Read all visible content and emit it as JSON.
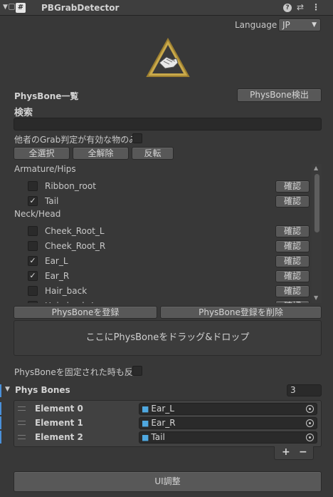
{
  "header": {
    "title": "PBGrabDetector",
    "script_icon": "#"
  },
  "language": {
    "label": "Language",
    "value": "JP"
  },
  "logo": {
    "icon": "grab-hand-warning-icon"
  },
  "physbone_list": {
    "title": "PhysBone一覧",
    "detect_button": "PhysBone検出",
    "search_label": "検索",
    "search_value": "",
    "other_grab_label": "他者のGrab判定が有効な物のみ",
    "other_grab_checked": false,
    "select_all": "全選択",
    "deselect_all": "全解除",
    "invert": "反転"
  },
  "groups": [
    {
      "name": "Armature/Hips",
      "items": [
        {
          "label": "Ribbon_root",
          "checked": false,
          "button": "確認"
        },
        {
          "label": "Tail",
          "checked": true,
          "button": "確認"
        }
      ]
    },
    {
      "name": "Neck/Head",
      "items": [
        {
          "label": "Cheek_Root_L",
          "checked": false,
          "button": "確認"
        },
        {
          "label": "Cheek_Root_R",
          "checked": false,
          "button": "確認"
        },
        {
          "label": "Ear_L",
          "checked": true,
          "button": "確認"
        },
        {
          "label": "Ear_R",
          "checked": true,
          "button": "確認"
        },
        {
          "label": "Hair_back",
          "checked": false,
          "button": "確認"
        },
        {
          "label": "Hair_back_L",
          "checked": false,
          "button": "確認"
        }
      ]
    }
  ],
  "register_button": "PhysBoneを登録",
  "unregister_button": "PhysBone登録を削除",
  "dropzone_text": "ここにPhysBoneをドラッグ&ドロップ",
  "fixed_react": {
    "label": "PhysBoneを固定された時も反応",
    "checked": false
  },
  "phys_bones": {
    "title": "Phys Bones",
    "count": "3",
    "elements": [
      {
        "label": "Element 0",
        "value": "Ear_L"
      },
      {
        "label": "Element 1",
        "value": "Ear_R"
      },
      {
        "label": "Element 2",
        "value": "Tail"
      }
    ],
    "add_label": "+",
    "remove_label": "−"
  },
  "ui_adjust_button": "UI調整",
  "colors": {
    "background": "#383838",
    "button": "#585858",
    "field": "#2a2a2a",
    "logo_triangle": "#c9a94a",
    "accent_blue": "#4a90d9"
  }
}
